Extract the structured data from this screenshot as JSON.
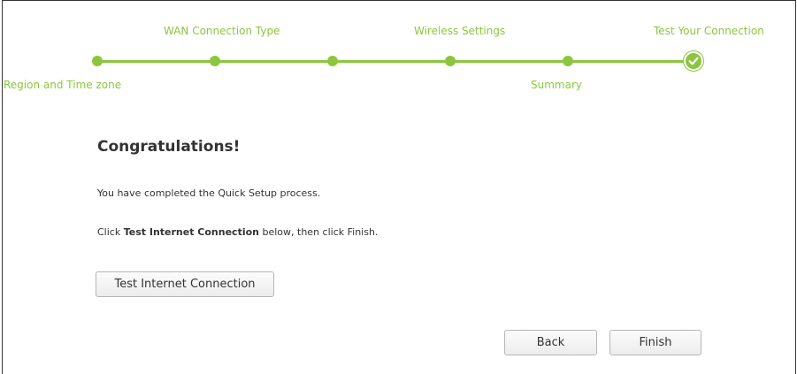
{
  "steps": {
    "region": "Region and Time zone",
    "wan": "WAN Connection Type",
    "wireless": "Wireless Settings",
    "summary": "Summary",
    "test": "Test Your Connection"
  },
  "content": {
    "title": "Congratulations!",
    "completed": "You have completed the Quick Setup process.",
    "instruction_prefix": "Click ",
    "instruction_bold": "Test Internet Connection",
    "instruction_suffix": " below, then click Finish."
  },
  "buttons": {
    "test_connection": "Test Internet Connection",
    "back": "Back",
    "finish": "Finish"
  },
  "colors": {
    "accent": "#8cc63f",
    "text": "#333333"
  },
  "icons": {
    "current_step": "check-circle-icon"
  }
}
